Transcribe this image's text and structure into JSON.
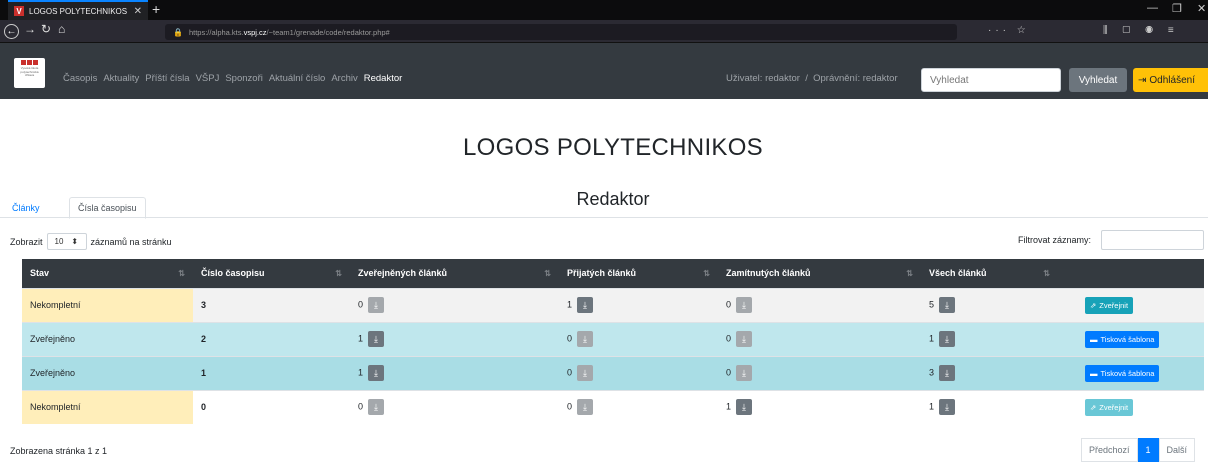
{
  "browser": {
    "tab_title": "LOGOS POLYTECHNIKOS",
    "url_prefix": "https://alpha.kts.",
    "url_domain": "vspj.cz",
    "url_rest": "/~team1/grenade/code/redaktor.php#"
  },
  "nav": {
    "links": [
      "Časopis",
      "Aktuality",
      "Příští čísla",
      "VŠPJ",
      "Sponzoři",
      "Aktuální číslo",
      "Archiv",
      "Redaktor"
    ],
    "user_text": "Uživatel: redaktor  /  Oprávnění: redaktor",
    "search_placeholder": "Vyhledat",
    "search_button": "Vyhledat",
    "logout_button": "Odhlášení"
  },
  "page": {
    "title": "LOGOS POLYTECHNIKOS",
    "subtitle": "Redaktor"
  },
  "tabs": [
    "Články",
    "Čísla časopisu"
  ],
  "table_controls": {
    "show_prefix": "Zobrazit",
    "page_size": "10",
    "show_suffix": "záznamů na stránku",
    "filter_label": "Filtrovat záznamy:"
  },
  "table": {
    "headers": [
      "Stav",
      "Číslo časopisu",
      "Zveřejněných článků",
      "Přijatých článků",
      "Zamítnutých článků",
      "Všech článků",
      ""
    ],
    "rows": [
      {
        "stav": "Nekompletní",
        "cislo": "3",
        "zverejnenych": "0",
        "prijatych": "1",
        "zamitnutych": "0",
        "vsech": "5",
        "action": "Zveřejnit"
      },
      {
        "stav": "Zveřejněno",
        "cislo": "2",
        "zverejnenych": "1",
        "prijatych": "0",
        "zamitnutych": "0",
        "vsech": "1",
        "action": "Tisková šablona"
      },
      {
        "stav": "Zveřejněno",
        "cislo": "1",
        "zverejnenych": "1",
        "prijatych": "0",
        "zamitnutych": "0",
        "vsech": "3",
        "action": "Tisková šablona"
      },
      {
        "stav": "Nekompletní",
        "cislo": "0",
        "zverejnenych": "0",
        "prijatych": "0",
        "zamitnutych": "1",
        "vsech": "1",
        "action": "Zveřejnit"
      }
    ]
  },
  "footer": {
    "info": "Zobrazena stránka 1 z 1",
    "prev": "Předchozí",
    "page": "1",
    "next": "Další"
  }
}
